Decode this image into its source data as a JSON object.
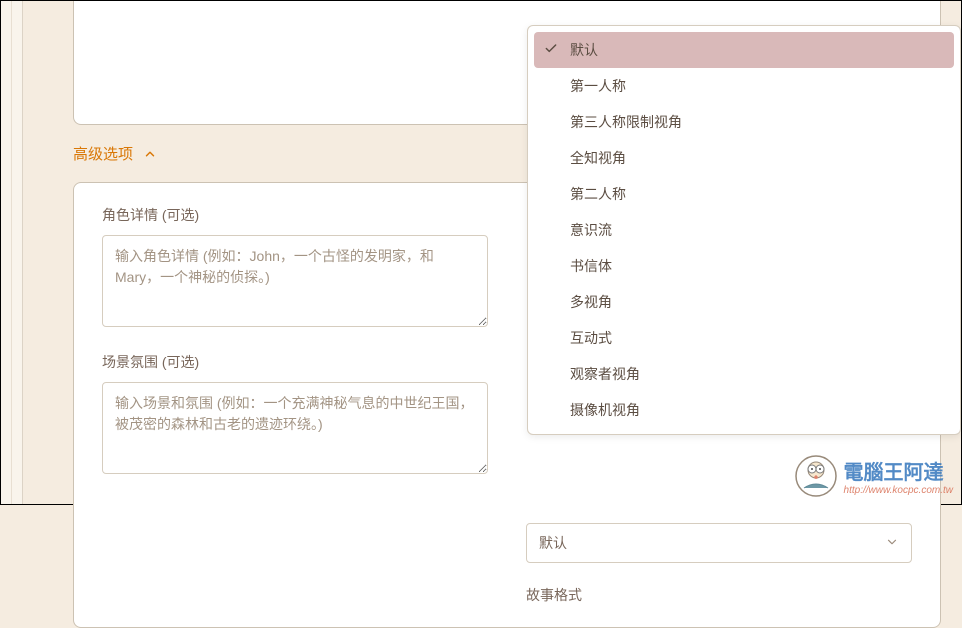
{
  "advanced": {
    "toggle_label": "高级选项"
  },
  "fields": {
    "character": {
      "label": "角色详情 (可选)",
      "placeholder": "输入角色详情 (例如：John，一个古怪的发明家，和Mary，一个神秘的侦探。)"
    },
    "scene": {
      "label": "场景氛围 (可选)",
      "placeholder": "输入场景和氛围 (例如：一个充满神秘气息的中世纪王国，被茂密的森林和古老的遗迹环绕。)"
    },
    "perspective_select": {
      "value": "默认"
    },
    "story_format": {
      "label": "故事格式"
    }
  },
  "dropdown": {
    "items": [
      {
        "label": "默认",
        "selected": true
      },
      {
        "label": "第一人称",
        "selected": false
      },
      {
        "label": "第三人称限制视角",
        "selected": false
      },
      {
        "label": "全知视角",
        "selected": false
      },
      {
        "label": "第二人称",
        "selected": false
      },
      {
        "label": "意识流",
        "selected": false
      },
      {
        "label": "书信体",
        "selected": false
      },
      {
        "label": "多视角",
        "selected": false
      },
      {
        "label": "互动式",
        "selected": false
      },
      {
        "label": "观察者视角",
        "selected": false
      },
      {
        "label": "摄像机视角",
        "selected": false
      }
    ]
  },
  "watermark": {
    "title": "電腦王阿達",
    "url": "http://www.kocpc.com.tw"
  }
}
